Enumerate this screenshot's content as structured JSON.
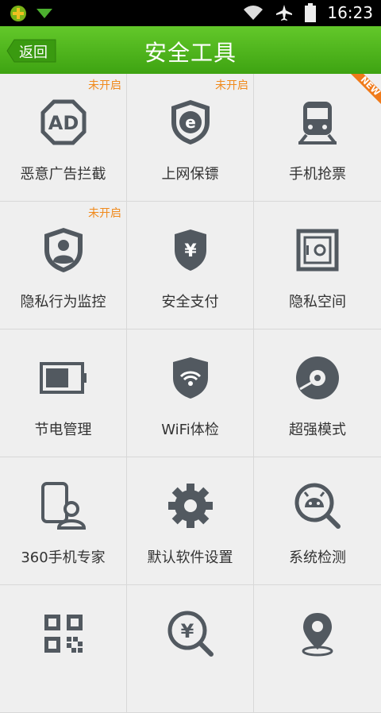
{
  "status": {
    "time": "16:23"
  },
  "header": {
    "back_label": "返回",
    "title": "安全工具"
  },
  "tools": [
    {
      "label": "恶意广告拦截",
      "badge": "未开启",
      "icon": "ad-block-icon"
    },
    {
      "label": "上网保镖",
      "badge": "未开启",
      "icon": "browser-shield-icon"
    },
    {
      "label": "手机抢票",
      "badge": "",
      "ribbon": "NEW",
      "icon": "train-icon"
    },
    {
      "label": "隐私行为监控",
      "badge": "未开启",
      "icon": "privacy-shield-icon"
    },
    {
      "label": "安全支付",
      "badge": "",
      "icon": "yuan-shield-icon"
    },
    {
      "label": "隐私空间",
      "badge": "",
      "icon": "safe-box-icon"
    },
    {
      "label": "节电管理",
      "badge": "",
      "icon": "battery-icon"
    },
    {
      "label": "WiFi体检",
      "badge": "",
      "icon": "wifi-shield-icon"
    },
    {
      "label": "超强模式",
      "badge": "",
      "icon": "disc-icon"
    },
    {
      "label": "360手机专家",
      "badge": "",
      "icon": "phone-expert-icon"
    },
    {
      "label": "默认软件设置",
      "badge": "",
      "icon": "gear-icon"
    },
    {
      "label": "系统检测",
      "badge": "",
      "icon": "android-search-icon"
    },
    {
      "label": "",
      "badge": "",
      "icon": "qr-code-icon"
    },
    {
      "label": "",
      "badge": "",
      "icon": "yuan-search-icon"
    },
    {
      "label": "",
      "badge": "",
      "icon": "location-pin-icon"
    }
  ]
}
